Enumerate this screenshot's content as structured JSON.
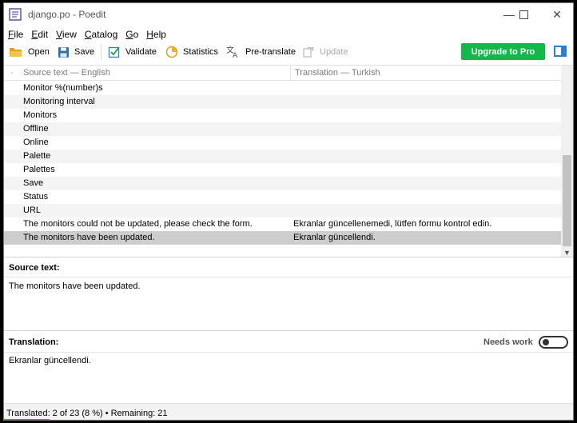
{
  "window": {
    "title": "django.po - Poedit",
    "controls": {
      "minimize": "—",
      "maximize": "☐",
      "close": "✕"
    }
  },
  "menu": [
    {
      "label": "File",
      "mnemonic": "F",
      "rest": "ile"
    },
    {
      "label": "Edit",
      "mnemonic": "E",
      "rest": "dit"
    },
    {
      "label": "View",
      "mnemonic": "V",
      "rest": "iew"
    },
    {
      "label": "Catalog",
      "mnemonic": "C",
      "rest": "atalog"
    },
    {
      "label": "Go",
      "mnemonic": "G",
      "rest": "o"
    },
    {
      "label": "Help",
      "mnemonic": "H",
      "rest": "elp"
    }
  ],
  "toolbar": {
    "open": "Open",
    "save": "Save",
    "validate": "Validate",
    "statistics": "Statistics",
    "pretranslate": "Pre-translate",
    "update": "Update",
    "upgrade": "Upgrade to Pro"
  },
  "list": {
    "header_mark": "·",
    "col_source": "Source text — English",
    "col_translation": "Translation — Turkish",
    "rows": [
      {
        "source": "Monitor %(number)s",
        "translation": ""
      },
      {
        "source": "Monitoring interval",
        "translation": ""
      },
      {
        "source": "Monitors",
        "translation": ""
      },
      {
        "source": "Offline",
        "translation": ""
      },
      {
        "source": "Online",
        "translation": ""
      },
      {
        "source": "Palette",
        "translation": ""
      },
      {
        "source": "Palettes",
        "translation": ""
      },
      {
        "source": "Save",
        "translation": ""
      },
      {
        "source": "Status",
        "translation": ""
      },
      {
        "source": "URL",
        "translation": ""
      },
      {
        "source": "The monitors could not be updated, please check the form.",
        "translation": "Ekranlar güncellenemedi, lütfen formu kontrol edin."
      },
      {
        "source": "The monitors have been updated.",
        "translation": "Ekranlar güncellendi."
      }
    ],
    "selected_index": 11
  },
  "source_pane": {
    "label": "Source text:",
    "text": "The monitors have been updated."
  },
  "translation_pane": {
    "label": "Translation:",
    "needs_work_label": "Needs work",
    "needs_work": false,
    "text": "Ekranlar güncellendi."
  },
  "status": {
    "text": "Translated: 2 of 23 (8 %)  •  Remaining: 21",
    "progress_fraction": 0.08
  },
  "colors": {
    "upgrade_button": "#12b84a",
    "selection": "#cdcdcd",
    "accent": "#2f7fd0"
  },
  "icons": {
    "app": "poedit-app-icon",
    "open": "folder-icon",
    "save": "floppy-icon",
    "validate": "checkbox-icon",
    "statistics": "pie-chart-icon",
    "pretranslate": "translate-icon",
    "update": "update-icon",
    "sidebar": "sidebar-toggle-icon"
  }
}
